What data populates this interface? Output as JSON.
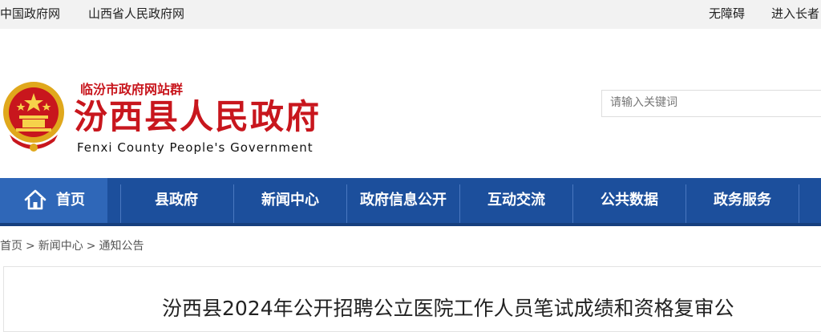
{
  "topbar": {
    "left_links": [
      "中国政府网",
      "山西省人民政府网"
    ],
    "right_links": [
      "无障碍",
      "进入长者"
    ]
  },
  "header": {
    "site_group": "临汾市政府网站群",
    "title": "汾西县人民政府",
    "subtitle_en": "Fenxi County People's Government"
  },
  "search": {
    "placeholder": "请输入关键词"
  },
  "nav": {
    "home": "首页",
    "items": [
      "县政府",
      "新闻中心",
      "政府信息公开",
      "互动交流",
      "公共数据",
      "政务服务"
    ]
  },
  "breadcrumb": {
    "items": [
      "首页",
      "新闻中心",
      "通知公告"
    ],
    "separator": ">"
  },
  "article": {
    "title": "汾西县2024年公开招聘公立医院工作人员笔试成绩和资格复审公"
  },
  "colors": {
    "brand_red": "#c8161d",
    "nav_blue": "#1c4f9c",
    "nav_home_blue": "#2f67b8"
  }
}
